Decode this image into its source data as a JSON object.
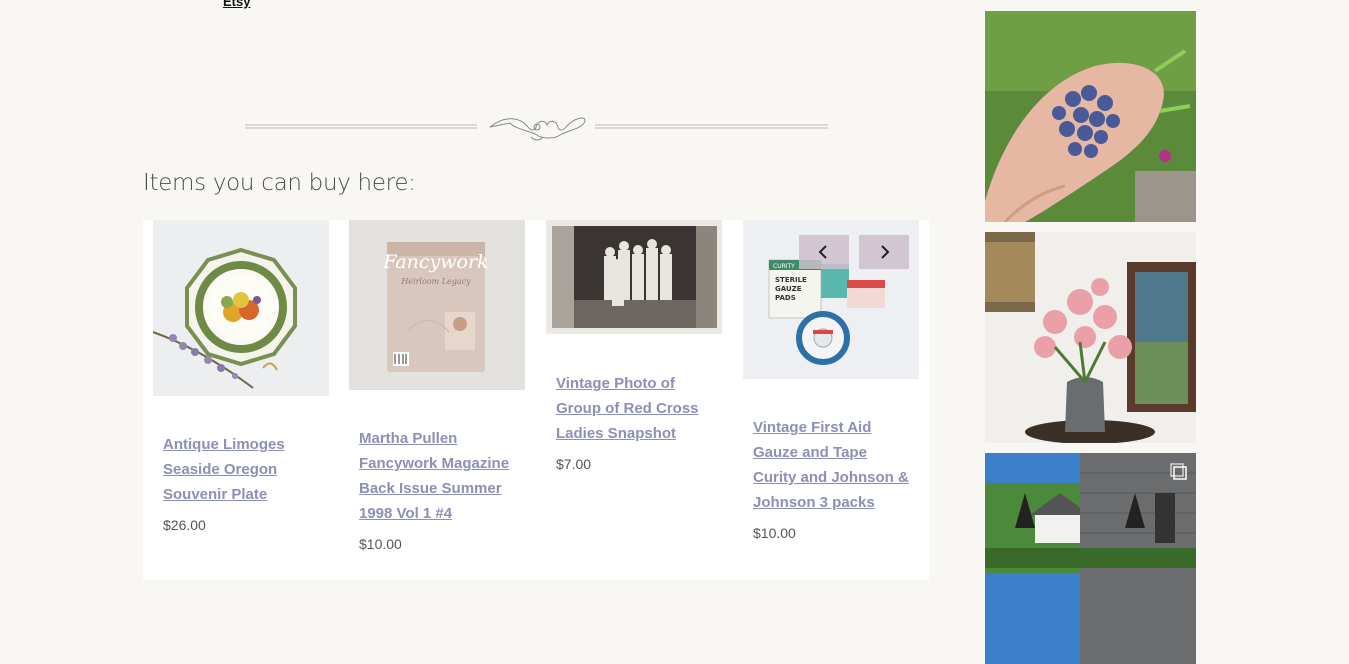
{
  "header": {
    "etsy_link": "Etsy"
  },
  "section": {
    "title": "Items you can buy here:"
  },
  "products": [
    {
      "title": "Antique Limoges Seaside Oregon Souvenir Plate",
      "price": "$26.00"
    },
    {
      "title": "Martha Pullen Fancywork Magazine Back Issue Summer 1998 Vol 1 #4",
      "price": "$10.00"
    },
    {
      "title": "Vintage Photo of Group of Red Cross Ladies Snapshot",
      "price": "$7.00"
    },
    {
      "title": "Vintage First Aid Gauze and Tape Curity and Johnson & Johnson 3 packs",
      "price": "$10.00"
    }
  ],
  "carousel": {
    "prev_icon": "chevron-left-icon",
    "next_icon": "chevron-right-icon"
  },
  "magazine_cover": {
    "title": "Fancywork",
    "subtitle": "Heirloom Legacy"
  },
  "gauze_box": {
    "brand": "CURITY",
    "label_lines": [
      "STERILE",
      "GAUZE",
      "PADS"
    ]
  },
  "sidebar": {
    "instagram_posts": [
      {
        "subject": "blueberries"
      },
      {
        "subject": "lilies"
      },
      {
        "subject": "house",
        "badge_icon": "multiple-photos-icon"
      }
    ]
  },
  "colors": {
    "link": "#8c8fb6",
    "nav_button": "#cdbecd",
    "background": "#f8f7f4"
  }
}
